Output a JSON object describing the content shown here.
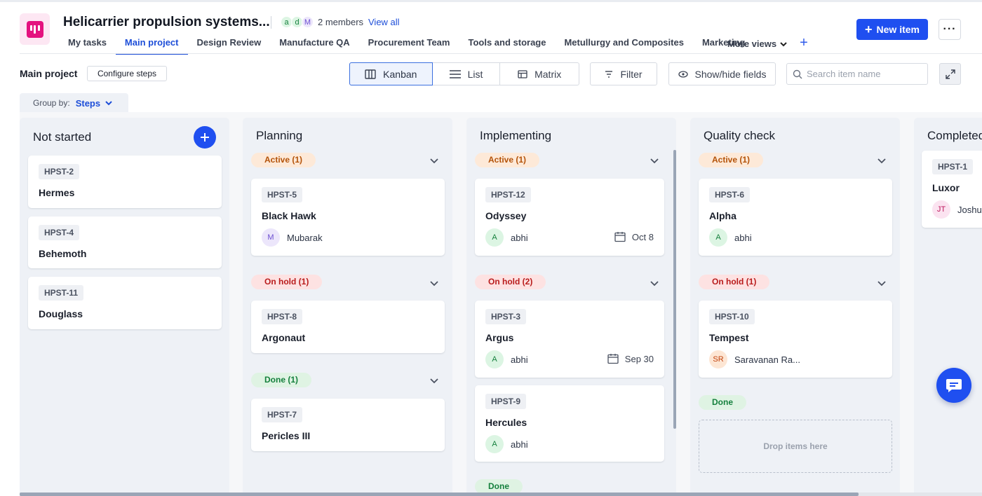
{
  "header": {
    "project_title": "Helicarrier propulsion systems...",
    "member_avatars": [
      {
        "letter": "a",
        "bg": "#dcf5e3",
        "fg": "#15803d"
      },
      {
        "letter": "d",
        "bg": "#dcf5e3",
        "fg": "#15803d"
      },
      {
        "letter": "M",
        "bg": "#ece6fb",
        "fg": "#6d4fd1"
      }
    ],
    "members_text": "2 members",
    "view_all": "View all",
    "tabs": [
      "My tasks",
      "Main project",
      "Design Review",
      "Manufacture QA",
      "Procurement Team",
      "Tools and storage",
      "Metullurgy and Composites",
      "Marketing"
    ],
    "more_views": "More views",
    "new_item": "New item"
  },
  "toolbar": {
    "page_name": "Main project",
    "configure_steps": "Configure steps",
    "views": [
      "Kanban",
      "List",
      "Matrix"
    ],
    "filter": "Filter",
    "show_hide": "Show/hide fields",
    "search_placeholder": "Search item name",
    "group_by_label": "Group by:",
    "group_by_value": "Steps"
  },
  "columns": [
    {
      "title": "Not started",
      "cards": [
        {
          "id": "HPST-2",
          "name": "Hermes"
        },
        {
          "id": "HPST-4",
          "name": "Behemoth"
        },
        {
          "id": "HPST-11",
          "name": "Douglass"
        }
      ]
    },
    {
      "title": "Planning",
      "groups": [
        {
          "label": "Active (1)",
          "cards": [
            {
              "id": "HPST-5",
              "name": "Black Hawk",
              "assignee": "Mubarak",
              "initials": "M"
            }
          ]
        },
        {
          "label": "On hold (1)",
          "cards": [
            {
              "id": "HPST-8",
              "name": "Argonaut"
            }
          ]
        },
        {
          "label": "Done (1)",
          "cards": [
            {
              "id": "HPST-7",
              "name": "Pericles III"
            }
          ]
        }
      ]
    },
    {
      "title": "Implementing",
      "groups": [
        {
          "label": "Active (1)",
          "cards": [
            {
              "id": "HPST-12",
              "name": "Odyssey",
              "assignee": "abhi",
              "initials": "A",
              "date": "Oct 8"
            }
          ]
        },
        {
          "label": "On hold (2)",
          "cards": [
            {
              "id": "HPST-3",
              "name": "Argus",
              "assignee": "abhi",
              "initials": "A",
              "date": "Sep 30"
            },
            {
              "id": "HPST-9",
              "name": "Hercules",
              "assignee": "abhi",
              "initials": "A"
            }
          ]
        },
        {
          "label": "Done"
        }
      ]
    },
    {
      "title": "Quality check",
      "groups": [
        {
          "label": "Active (1)",
          "cards": [
            {
              "id": "HPST-6",
              "name": "Alpha",
              "assignee": "abhi",
              "initials": "A"
            }
          ]
        },
        {
          "label": "On hold (1)",
          "cards": [
            {
              "id": "HPST-10",
              "name": "Tempest",
              "assignee": "Saravanan Ra...",
              "initials": "SR"
            }
          ]
        },
        {
          "label": "Done",
          "dropzone": "Drop items here"
        }
      ]
    },
    {
      "title": "Completed",
      "cards": [
        {
          "id": "HPST-1",
          "name": "Luxor",
          "assignee": "Joshua",
          "initials": "JT"
        }
      ]
    }
  ],
  "colors": {
    "accent": "#1f4ff0",
    "active_pill": "#fde9d8",
    "hold_pill": "#fde2e2",
    "done_pill": "#dff3e3",
    "avatar_green": "#dcf5e3",
    "avatar_purple": "#ece6fb",
    "avatar_orange": "#fde6d4",
    "avatar_pink": "#fbe3f0"
  },
  "icons": {
    "logo": "monday-board-icon",
    "chat": "chat-bubble-icon",
    "calendar": "calendar-icon"
  }
}
